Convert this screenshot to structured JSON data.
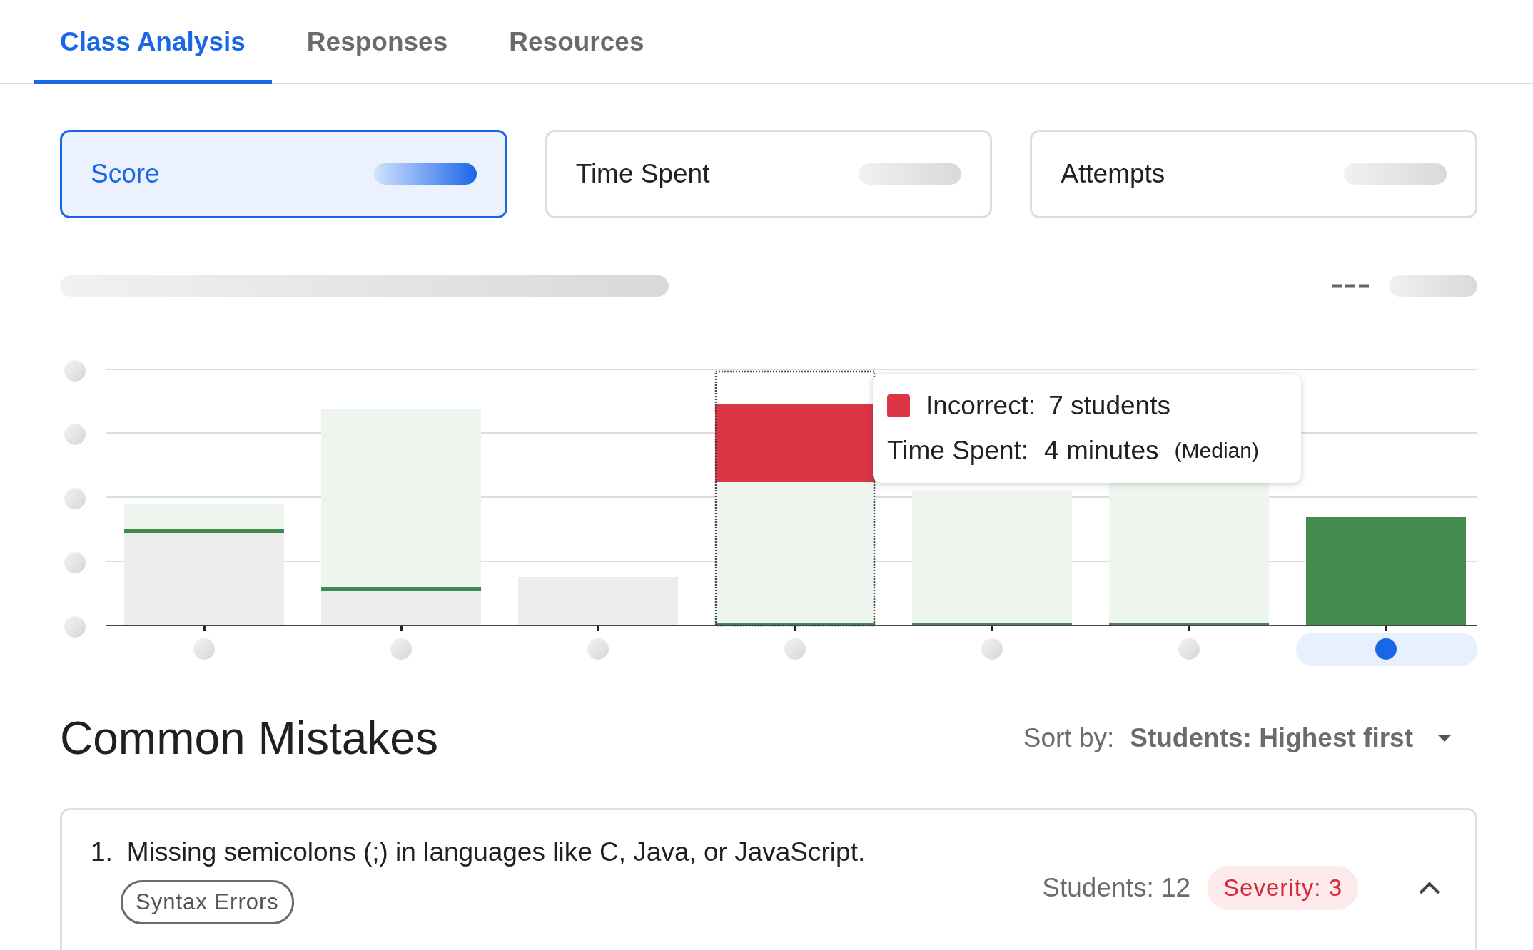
{
  "tabs": [
    {
      "label": "Class Analysis",
      "selected": true
    },
    {
      "label": "Responses",
      "selected": false
    },
    {
      "label": "Resources",
      "selected": false
    }
  ],
  "metric_cards": [
    {
      "label": "Score",
      "selected": true
    },
    {
      "label": "Time Spent",
      "selected": false
    },
    {
      "label": "Attempts",
      "selected": false
    }
  ],
  "chart": {
    "columns": [
      {
        "selected": false,
        "hovered": false
      },
      {
        "selected": false,
        "hovered": false
      },
      {
        "selected": false,
        "hovered": false
      },
      {
        "selected": false,
        "hovered": true
      },
      {
        "selected": false,
        "hovered": false
      },
      {
        "selected": false,
        "hovered": false
      },
      {
        "selected": true,
        "hovered": false
      }
    ],
    "tooltip": {
      "label": "Incorrect:",
      "value": "7 students",
      "time_label": "Time Spent:",
      "time_value": "4 minutes",
      "note": "(Median)"
    }
  },
  "common_mistakes": {
    "title": "Common Mistakes",
    "sort_label": "Sort by:",
    "sort_value": "Students: Highest first",
    "items": [
      {
        "number": "1.",
        "text": "Missing semicolons (;) in languages like C, Java, or JavaScript.",
        "tag": "Syntax Errors",
        "students": "Students: 12",
        "severity": "Severity: 3",
        "expanded": true
      }
    ]
  }
}
